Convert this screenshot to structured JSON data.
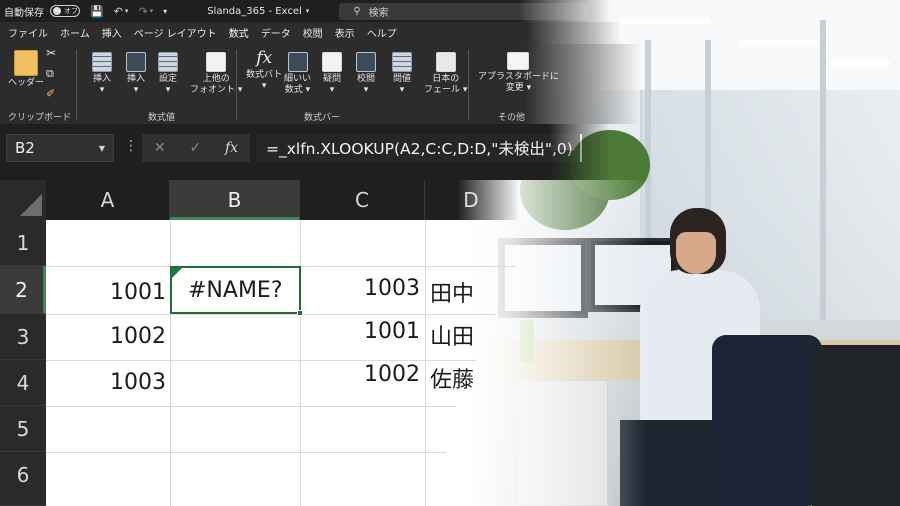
{
  "titlebar": {
    "autosave_label": "自動保存",
    "autosave_state": "オフ",
    "save_icon": "save-icon",
    "undo_icon": "undo-icon",
    "redo_icon": "redo-icon",
    "title": "Slanda_365  -  Excel",
    "search_placeholder": "検索"
  },
  "tabs": [
    {
      "label": "ファイル"
    },
    {
      "label": "ホーム"
    },
    {
      "label": "挿入"
    },
    {
      "label": "ページ レイアウト"
    },
    {
      "label": "数式",
      "active": true
    },
    {
      "label": "データ"
    },
    {
      "label": "校閲"
    },
    {
      "label": "表示"
    },
    {
      "label": "ヘルプ"
    }
  ],
  "ribbon": {
    "clipboard": {
      "paste": "ヘッダー",
      "group": "クリップボード"
    },
    "values": {
      "insert1": "挿入",
      "insert2": "挿入",
      "settings": "設定",
      "top_font": "上他の",
      "top_font2": "フォオント",
      "group": "数式値"
    },
    "formula": {
      "fx_label": "数式バト",
      "fine_label": "細いい",
      "fine_label2": "数式",
      "question": "疑問",
      "proofread": "校閲",
      "question2": "問値",
      "japan": "日本の",
      "japan2": "フェール",
      "group": "数式バー"
    },
    "other": {
      "dashboard": "アプラスタボードに",
      "change": "変更",
      "group": "その他"
    }
  },
  "formula_bar": {
    "name_box": "B2",
    "cancel_icon": "✕",
    "enter_icon": "✓",
    "fx_icon": "fx",
    "formula": "=_xlfn.XLOOKUP(A2,C:C,D:D,\"未検出\",0)"
  },
  "sheet": {
    "columns": [
      "A",
      "B",
      "C",
      "D"
    ],
    "rows": [
      "1",
      "2",
      "3",
      "4",
      "5",
      "6"
    ],
    "cells": {
      "A2": "1001",
      "B2": "#NAME?",
      "C2": "1003",
      "D2": "田中",
      "A3": "1002",
      "C3": "1001",
      "D3": "山田",
      "A4": "1003",
      "C4": "1002",
      "D4": "佐藤"
    },
    "selected_cell": "B2",
    "accent_color": "#1f6b3a"
  }
}
